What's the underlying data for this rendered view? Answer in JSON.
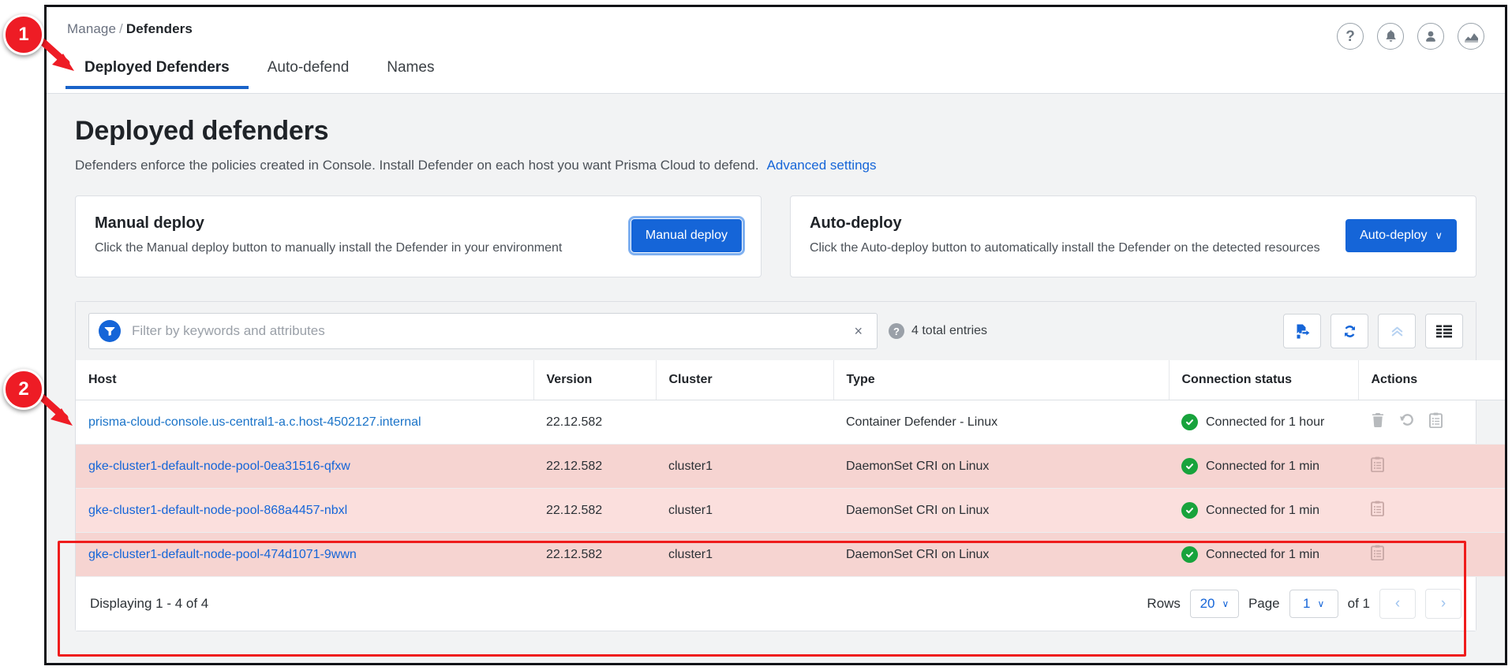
{
  "breadcrumb": {
    "parent": "Manage",
    "separator": "/",
    "current": "Defenders"
  },
  "tabs": [
    {
      "label": "Deployed Defenders",
      "active": true
    },
    {
      "label": "Auto-defend",
      "active": false
    },
    {
      "label": "Names",
      "active": false
    }
  ],
  "top_icons": [
    {
      "name": "help-icon",
      "glyph": "?"
    },
    {
      "name": "notifications-bell-icon",
      "glyph": "bell"
    },
    {
      "name": "user-account-icon",
      "glyph": "user"
    },
    {
      "name": "analytics-chart-icon",
      "glyph": "chart"
    }
  ],
  "page": {
    "title": "Deployed defenders",
    "description": "Defenders enforce the policies created in Console. Install Defender on each host you want Prisma Cloud to defend.",
    "advanced_link": "Advanced settings"
  },
  "cards": {
    "manual": {
      "title": "Manual deploy",
      "description": "Click the Manual deploy button to manually install the Defender in your environment",
      "button_label": "Manual deploy"
    },
    "auto": {
      "title": "Auto-deploy",
      "description": "Click the Auto-deploy button to automatically install the Defender on the detected resources",
      "button_label": "Auto-deploy",
      "button_caret": "∨"
    }
  },
  "filter": {
    "placeholder": "Filter by keywords and attributes",
    "value": "",
    "clear_glyph": "×",
    "entries_text": "4 total entries",
    "help_glyph": "?"
  },
  "toolbar": [
    {
      "name": "export-button"
    },
    {
      "name": "refresh-button"
    },
    {
      "name": "collapse-button"
    },
    {
      "name": "column-settings-button"
    }
  ],
  "table": {
    "columns": [
      "Host",
      "Version",
      "Cluster",
      "Type",
      "Connection status",
      "Actions"
    ],
    "rows": [
      {
        "host": "prisma-cloud-console.us-central1-a.c.host-4502127.internal",
        "version": "22.12.582",
        "cluster": "",
        "type": "Container Defender - Linux",
        "status": "Connected for 1 hour",
        "highlighted": false,
        "actions": [
          "trash-icon",
          "restore-icon",
          "logs-icon"
        ]
      },
      {
        "host": "gke-cluster1-default-node-pool-0ea31516-qfxw",
        "version": "22.12.582",
        "cluster": "cluster1",
        "type": "DaemonSet CRI on Linux",
        "status": "Connected for 1 min",
        "highlighted": true,
        "actions": [
          "logs-icon"
        ]
      },
      {
        "host": "gke-cluster1-default-node-pool-868a4457-nbxl",
        "version": "22.12.582",
        "cluster": "cluster1",
        "type": "DaemonSet CRI on Linux",
        "status": "Connected for 1 min",
        "highlighted": true,
        "actions": [
          "logs-icon"
        ]
      },
      {
        "host": "gke-cluster1-default-node-pool-474d1071-9wwn",
        "version": "22.12.582",
        "cluster": "cluster1",
        "type": "DaemonSet CRI on Linux",
        "status": "Connected for 1 min",
        "highlighted": true,
        "actions": [
          "logs-icon"
        ]
      }
    ]
  },
  "footer": {
    "displaying": "Displaying 1 - 4 of 4",
    "rows_label": "Rows",
    "rows_value": "20",
    "page_label": "Page",
    "page_value": "1",
    "of_label": "of 1",
    "prev_glyph": "‹",
    "next_glyph": "›"
  },
  "annotations": [
    {
      "number": "1"
    },
    {
      "number": "2"
    }
  ],
  "colors": {
    "accent_blue": "#1565d8",
    "link_blue": "#1565d8",
    "status_green": "#18a33c",
    "highlight_red": "#ef1c1c",
    "row_highlight_a": "#f6d4d1",
    "row_highlight_b": "#fbdfdd"
  }
}
